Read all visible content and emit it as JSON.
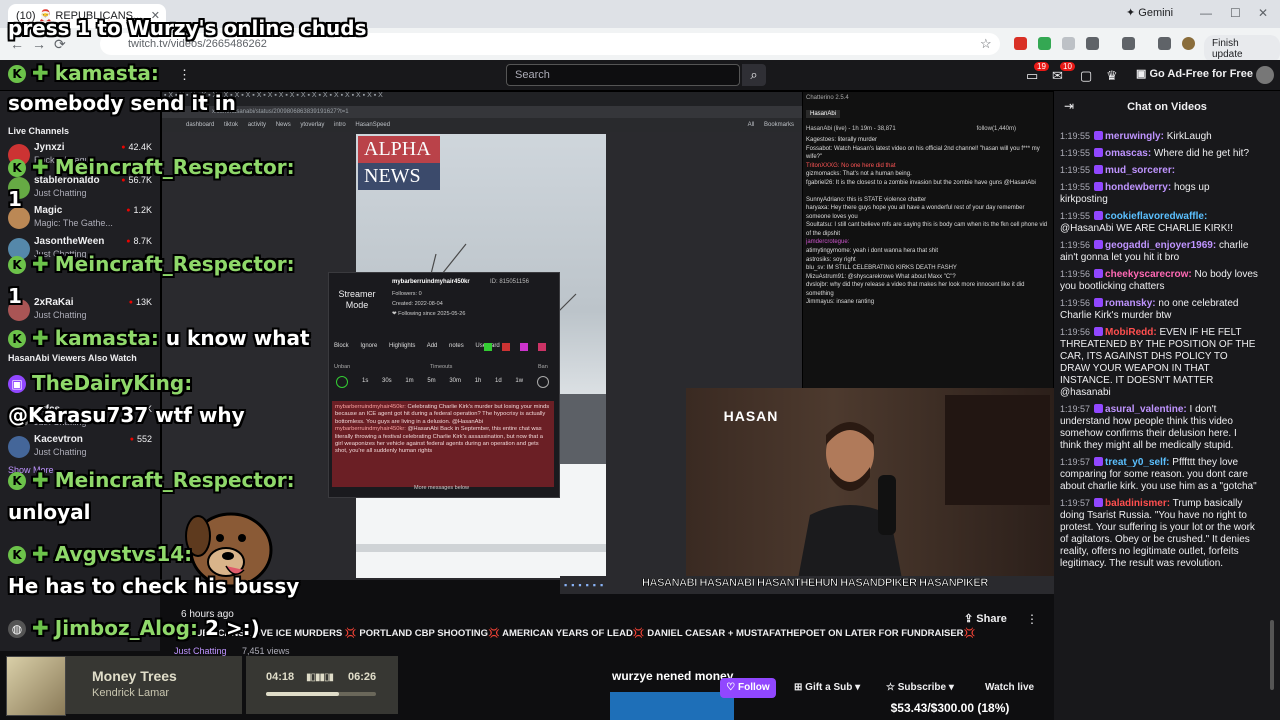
{
  "browser": {
    "tab_title": "(10) 🎅 REPUBLICANS...",
    "url": "twitch.tv/videos/2665486262",
    "gemini_label": "Gemini",
    "finish_update_label": "Finish update"
  },
  "twitch_nav": {
    "search_placeholder": "Search",
    "ad_free_label": "Go Ad-Free for Free",
    "badge_notifications": "19",
    "badge_inbox": "10"
  },
  "sidebar": {
    "live_channels_header": "Live Channels",
    "also_watch_header": "HasanAbi Viewers Also Watch",
    "show_more": "Show More",
    "channels": [
      {
        "name": "Jynxzi",
        "game": "Rocket League",
        "viewers": "42.4K"
      },
      {
        "name": "stableronaldo",
        "game": "Just Chatting",
        "viewers": "56.7K"
      },
      {
        "name": "Magic",
        "game": "Magic: The Gathe...",
        "viewers": "1.2K"
      },
      {
        "name": "JasontheWeen",
        "game": "Just Chatting",
        "viewers": "8.7K"
      },
      {
        "name": "2xRaKai",
        "game": "Just Chatting",
        "viewers": "13K"
      }
    ],
    "also_watch": [
      {
        "name": "wrfcs",
        "game": "Just Chatting",
        "viewers": "19K"
      },
      {
        "name": "Kacevtron",
        "game": "Just Chatting",
        "viewers": "552"
      }
    ]
  },
  "overlay_chat": [
    {
      "user": "press 1 to Wurzy's online chuds",
      "msg": ""
    },
    {
      "user": "kamasta:",
      "msg": "somebody send it in"
    },
    {
      "user": "Meincraft_Respector:",
      "msg": "1"
    },
    {
      "user": "Meincraft_Respector:",
      "msg": "1"
    },
    {
      "user": "kamasta:",
      "msg": "u know what"
    },
    {
      "user": "TheDairyKing:",
      "msg": "@Karasu737 wtf why"
    },
    {
      "user": "Meincraft_Respector:",
      "msg": "unloyal"
    },
    {
      "user": "Avgvstvs14:",
      "msg": "He has to check his bussy"
    },
    {
      "user": "Jimboz_Alog:",
      "msg": "2 >:)"
    }
  ],
  "stream_screen": {
    "news_brand_1": "ALPHA",
    "news_brand_2": "NEWS",
    "inner_url": "x.com/hasanabi/status/2009806863839191627?t=1",
    "bookmarks": "dashboard  tiktok  activity  News  ytoverlay  intro  HasanSpeed",
    "all_bookmarks": "All Bookmarks"
  },
  "usercard": {
    "mode": "Streamer Mode",
    "username": "mybarberruindmyhair450kr",
    "id": "ID: 815051156",
    "followers": "Followers: 0",
    "created": "Created: 2022-08-04",
    "following": "❤ Following since 2025-05-26",
    "actions": "Block  Ignore Highlights  Add notes  Usercard",
    "unban": "Unban",
    "timeouts": "Timeouts",
    "ban": "Ban",
    "times": "1s 30s 1m 5m 30m 1h 1d 1w",
    "msg1_user": "mybarberruindmyhair450kr:",
    "msg1": "Celebrating Charlie Kirk's murder but losing your minds because an ICE agent got hit during a federal operation? The hypocrisy is actually bottomless. You guys are living in a delusion. @HasanAbi",
    "msg2_user": "mybarberruindmyhair450kr:",
    "msg2": "@HasanAbi Back in September, this entire chat was literally throwing a festival celebrating Charlie Kirk's assassination, but now that a girl weaponizes her vehicle against federal agents during an operation and gets shot, you're all suddenly human rights",
    "more": "More messages below"
  },
  "chatterino": {
    "title": "Chatterino 2.5.4",
    "tab": "HasanAbi",
    "header": "HasanAbi (live) - 1h 19m - 38,871",
    "header_right": "follow(1,440m)",
    "lines": [
      "Kagestoes: literally murder",
      "Fossabot: Watch Hasan's latest video on his official 2nd channel! \"hasan will you f*** my wife?\"",
      "TritonXXXG: No one here did that",
      "gizmomacks: That's not a human being.",
      "fgabriel26: It is the closest to a zombie invasion but the zombie have guns @HasanAbi",
      "SunnyAdriano: this is STATE violence chatter",
      "haryaxa: Hey there guys hope you all have a wonderful rest of your day remember someone loves you",
      "Soultatsu: I still cant believe mfs are saying this is body cam when its the fkn cell phone vid of the dipshit",
      "jamdercrotegue:",
      "atimytingymome: yeah i dont wanna hera that shit",
      "astrosiks: soy right",
      "blu_sv: IM STILL CELEBRATING KIRKS DEATH FASHY",
      "MizuAstrum91: @shyscarekrowe What about Maxx \"C\"?",
      "dvslojbr: why did they release a video that makes her look more innocent like it did something",
      "Jimmayus: insane ranting"
    ]
  },
  "webcam": {
    "logo_text": "HASAN"
  },
  "socials": "HASANABI  HASANABI  HASANTHEHUN  HASANDPIKER  HASANPIKER",
  "right_chat": {
    "title": "Chat on Videos",
    "messages": [
      {
        "time": "1:19:55",
        "user": "meruwingly:",
        "color": "#bf94ff",
        "text": "KirkLaugh"
      },
      {
        "time": "1:19:55",
        "user": "omascas:",
        "color": "#bf94ff",
        "text": "Where did he get hit?"
      },
      {
        "time": "1:19:55",
        "user": "mud_sorcerer:",
        "color": "#bf94ff",
        "text": ""
      },
      {
        "time": "1:19:55",
        "user": "hondewberry:",
        "color": "#bf94ff",
        "text": "hogs up kirkposting"
      },
      {
        "time": "1:19:55",
        "user": "cookieflavoredwaffle:",
        "color": "#5bc0ff",
        "text": "@HasanAbi WE ARE CHARLIE KIRK!!"
      },
      {
        "time": "1:19:56",
        "user": "geogaddi_enjoyer1969:",
        "color": "#bf94ff",
        "text": "charlie ain't gonna let you hit it bro"
      },
      {
        "time": "1:19:56",
        "user": "cheekyscarecrow:",
        "color": "#ff69b4",
        "text": "No body loves you bootlicking chatters"
      },
      {
        "time": "1:19:56",
        "user": "romansky:",
        "color": "#bf94ff",
        "text": "no one celebrated Charlie Kirk's murder btw"
      },
      {
        "time": "1:19:56",
        "user": "MobiRedd:",
        "color": "#ff4f4f",
        "text": "EVEN IF HE FELT THREATENED BY THE POSITION OF THE CAR, ITS AGAINST DHS POLICY TO DRAW YOUR WEAPON IN THAT INSTANCE. IT DOESN'T MATTER @hasanabi"
      },
      {
        "time": "1:19:57",
        "user": "asural_valentine:",
        "color": "#bf94ff",
        "text": "I don't understand how people think this video somehow confirms their delusion here. I think they might all be medically stupid."
      },
      {
        "time": "1:19:57",
        "user": "treat_y0_self:",
        "color": "#5bc0ff",
        "text": "Pfffttt they love comparing for some reason. you dont care about charlie kirk. you use him as a \"gotcha\""
      },
      {
        "time": "1:19:57",
        "user": "baladinismer:",
        "color": "#ff4f4f",
        "text": "Trump basically doing Tsarist Russia. \"You have no right to protest. Your suffering is your lot or the work of agitators. Obey or be crushed.\" It denies reality, offers no legitimate outlet, forfeits legitimacy. The result was revolution."
      }
    ]
  },
  "stream_info": {
    "ago": "6 hours ago",
    "title": "REPUBLICANS LOVE ICE MURDERS 💢 PORTLAND CBP SHOOTING💢 AMERICAN YEARS OF LEAD💢 DANIEL CAESAR + MUSTAFATHEPOET ON LATER FOR FUNDRAISER💢",
    "category": "Just Chatting",
    "views": "7,451 views",
    "share_label": "Share",
    "follow_label": "Follow",
    "gift_label": "Gift a Sub",
    "subscribe_label": "Subscribe",
    "watch_live_label": "Watch live",
    "money_text": "wurzye nened money",
    "goal_text": "$53.43/$300.00 (18%)"
  },
  "now_playing": {
    "track": "Money Trees",
    "artist": "Kendrick Lamar",
    "current": "04:18",
    "end": "06:26",
    "progress": 0.668
  },
  "colors": {
    "twitch_purple": "#9147ff",
    "overlay_green": "#8fd86a"
  }
}
